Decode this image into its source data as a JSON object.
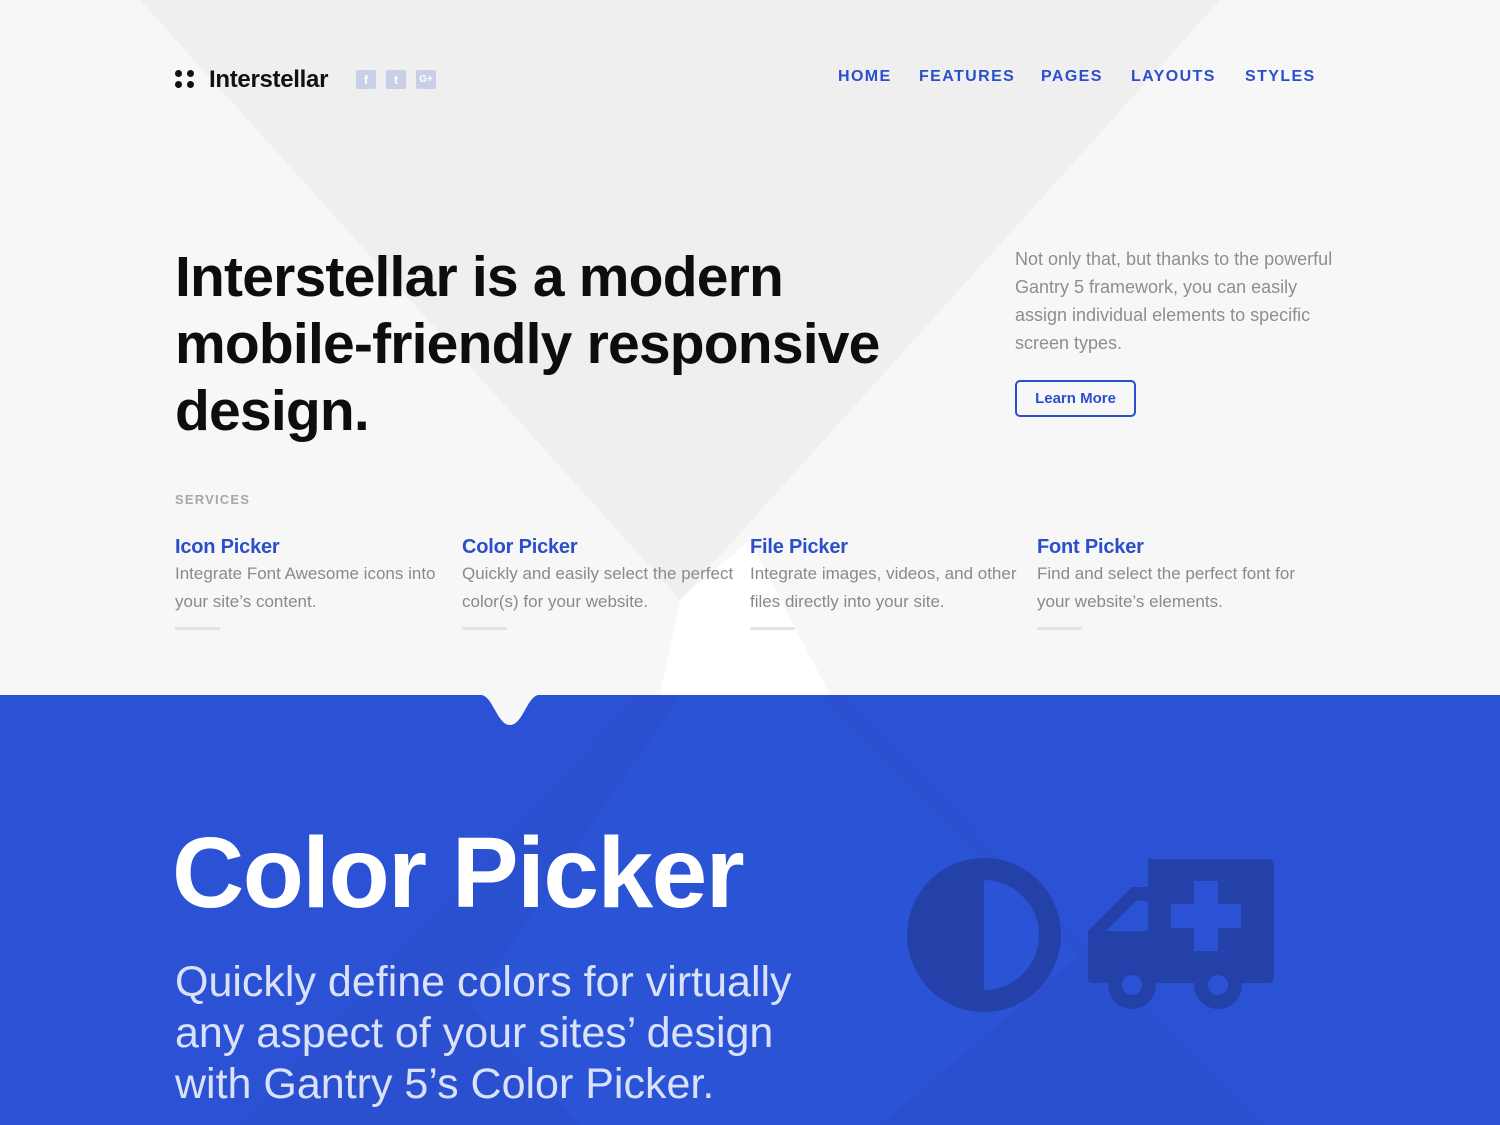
{
  "brand": {
    "name": "Interstellar"
  },
  "social": [
    {
      "icon": "facebook-icon",
      "glyph": "f"
    },
    {
      "icon": "twitter-icon",
      "glyph": "t"
    },
    {
      "icon": "google-plus-icon",
      "glyph": "G+"
    }
  ],
  "nav": {
    "home": "HOME",
    "features": "FEATURES",
    "pages": "PAGES",
    "layouts": "LAYOUTS",
    "styles": "STYLES"
  },
  "hero": {
    "headline": "Interstellar is a modern mobile-friendly responsive design.",
    "intro": "Not only that, but thanks to the powerful Gantry 5 framework, you can easily assign individual elements to specific screen types.",
    "button": "Learn More"
  },
  "services": {
    "label": "SERVICES",
    "items": [
      {
        "title": "Icon Picker",
        "desc": "Integrate Font Awesome icons into your site’s content."
      },
      {
        "title": "Color Picker",
        "desc": "Quickly and easily select the perfect color(s) for your website."
      },
      {
        "title": "File Picker",
        "desc": "Integrate images, videos, and other files directly into your site."
      },
      {
        "title": "Font Picker",
        "desc": "Find and select the perfect font for your website’s elements."
      }
    ]
  },
  "feature": {
    "title": "Color Picker",
    "desc": "Quickly define colors for virtually any aspect of your sites’ design with Gantry 5’s Color Picker.",
    "icons": [
      "adjust-icon",
      "ambulance-icon"
    ]
  },
  "colors": {
    "accent": "#2b4fcb",
    "feature_bg": "#2b52d4",
    "page_bg": "#f7f7f7"
  }
}
